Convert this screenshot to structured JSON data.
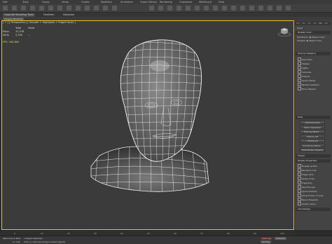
{
  "menu": [
    "Edit",
    "Tools",
    "Group",
    "Views",
    "Create",
    "Modifiers",
    "Animation",
    "Graph Editors",
    "Rendering",
    "Customize",
    "MAXScript",
    "Help"
  ],
  "ribbon": {
    "tabs": [
      "Graphite Modeling Tools",
      "Freeform",
      "Selection"
    ],
    "subtitle": "Polygon Modeling"
  },
  "viewport": {
    "label": "[ + ] [ Perspective ] [ Smooth + Highlights + Edged Faces ]",
    "stats": {
      "headers": [
        "",
        "Total",
        "Head"
      ],
      "rows": [
        [
          "Polys",
          "10,578",
          ""
        ],
        [
          "Verts",
          "5,300",
          "..."
        ],
        [
          "FPS",
          "...",
          ""
        ]
      ]
    },
    "fps_label": "FPS:",
    "fps_value": "160.864"
  },
  "command_panel": {
    "object_name": "Head",
    "rollout_selection": "Display Color",
    "rollout_hide_category": "Hide by Category",
    "hide_items": [
      "Geometry",
      "Shapes",
      "Lights",
      "Cameras",
      "Helpers",
      "Space Warps",
      "Particle Systems",
      "Bone Objects"
    ],
    "rollout_hide": "Hide",
    "hide_buttons": [
      "Hide Selected",
      "Hide Unselected",
      "Hide by Name...",
      "Hide by Hit",
      "Unhide All",
      "Unhide by Name...",
      "Hide Frozen Objects"
    ],
    "rollout_freeze": "Freeze",
    "rollout_display_properties": "Display Properties",
    "display_props": [
      "Display as Box",
      "Backface Cull",
      "Edges Only",
      "Vertex Ticks",
      "Trajectory",
      "See-Through",
      "Ignore Extents",
      "Show Frozen in Gray",
      "Never Degrade",
      "Vertex Colors"
    ],
    "rollout_link_display": "Link Display"
  },
  "timeline": {
    "ticks": [
      "0",
      "10",
      "20",
      "30",
      "40",
      "50",
      "60",
      "70",
      "80",
      "90",
      "100"
    ]
  },
  "status": {
    "selection": "1 Object Selected",
    "frame": "0 / 100",
    "prompt": "Click or click-and-drag to select objects",
    "auto_key": "Auto Key",
    "set_key": "Set Key",
    "key_filter": "Selected",
    "welcome": "Welcome to MAX"
  },
  "colors": {
    "viewport_border": "#f0c020",
    "panel_bg": "#444444",
    "viewport_bg": "#3b3b3b"
  }
}
